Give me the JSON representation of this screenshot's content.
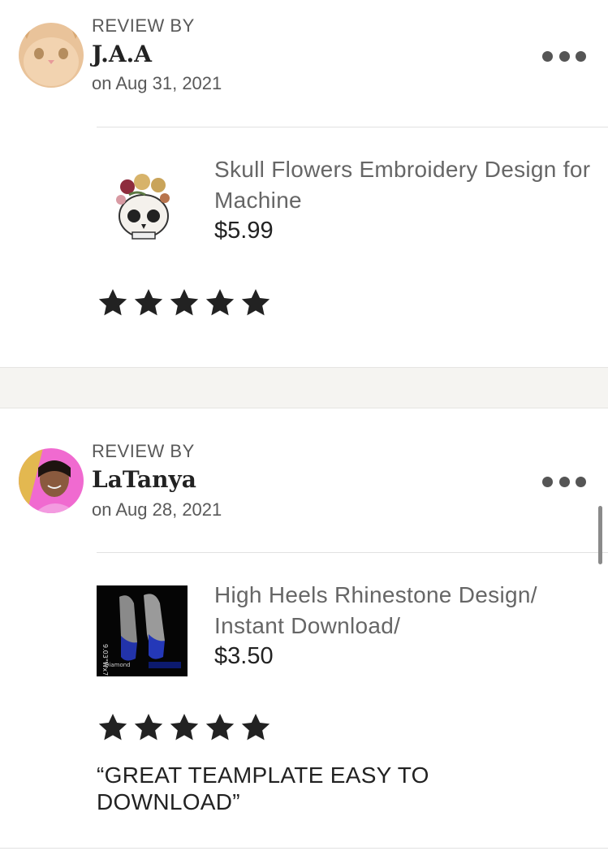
{
  "reviews": [
    {
      "label": "REVIEW BY",
      "name": "J.A.A",
      "date": "on Aug 31, 2021",
      "product_title": "Skull Flowers Embroidery Design for Machine",
      "price": "$5.99",
      "rating": 5,
      "quote": ""
    },
    {
      "label": "REVIEW BY",
      "name": "LaTanya",
      "date": "on Aug 28, 2021",
      "product_title": "High Heels Rhinestone Design/ Instant Download/",
      "price": "$3.50",
      "rating": 5,
      "quote": "“GREAT TEAMPLATE EASY TO DOWNLOAD”"
    }
  ],
  "icons": {
    "more": "more-horizontal-icon",
    "star": "star-icon"
  },
  "colors": {
    "star": "#222222",
    "muted_text": "#595959",
    "band": "#f5f4f1"
  }
}
